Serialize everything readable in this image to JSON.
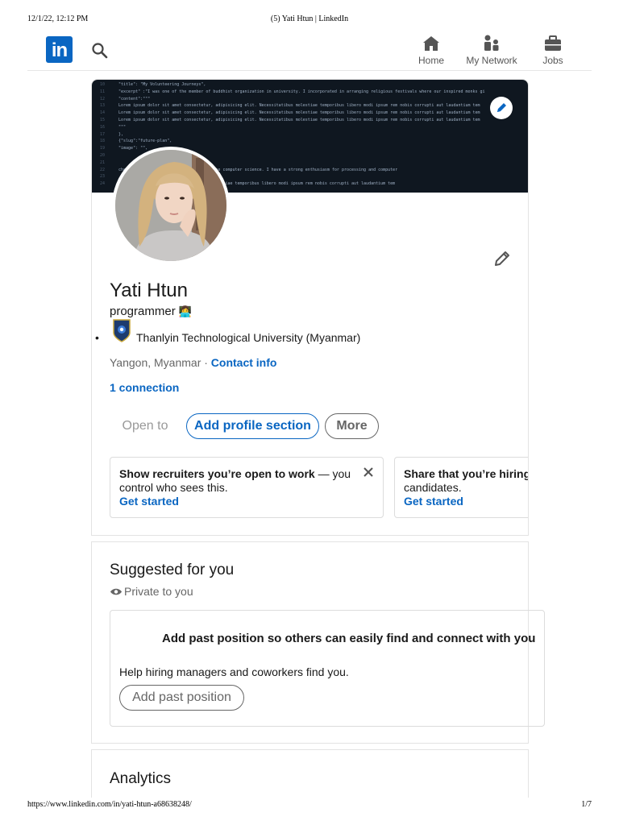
{
  "print": {
    "date": "12/1/22, 12:12 PM",
    "title": "(5) Yati Htun | LinkedIn",
    "url": "https://www.linkedin.com/in/yati-htun-a68638248/",
    "page": "1/7"
  },
  "nav": {
    "logo_text": "in",
    "items": [
      {
        "label": "Home",
        "icon": "home-icon"
      },
      {
        "label": "My Network",
        "icon": "network-icon"
      },
      {
        "label": "Jobs",
        "icon": "briefcase-icon"
      }
    ]
  },
  "banner": {
    "code_lines": [
      {
        "n": "10",
        "text": "    \"title\": \"My Volunteering Journeys\","
      },
      {
        "n": "11",
        "text": "    \"excerpt\" :\"I was one of the member of buddhist organization in university. I incorporated in arranging religious festivals where our inspired monks gi"
      },
      {
        "n": "12",
        "text": "    \"content\":\"\"\""
      },
      {
        "n": "13",
        "text": "      Lorem ipsum dolor sit amet consectetur, adipisicing elit. Necessitatibus molestiae temporibus libero modi ipsum rem nobis corrupti aut laudantium tem"
      },
      {
        "n": "14",
        "text": "      Lorem ipsum dolor sit amet consectetur, adipisicing elit. Necessitatibus molestiae temporibus libero modi ipsum rem nobis corrupti aut laudantium tem"
      },
      {
        "n": "15",
        "text": "      Lorem ipsum dolor sit amet consectetur, adipisicing elit. Necessitatibus molestiae temporibus libero modi ipsum rem nobis corrupti aut laudantium tem"
      },
      {
        "n": "16",
        "text": "    \"\"\""
      },
      {
        "n": "17",
        "text": "  },"
      },
      {
        "n": "18",
        "text": "  {\"slug\":\"future-plan\","
      },
      {
        "n": "19",
        "text": "    \"image\": \"\","
      },
      {
        "n": "20",
        "text": ""
      },
      {
        "n": "21",
        "text": ""
      },
      {
        "n": "22",
        "text": "                            challenging to myself , I became to choose computer science. I have a strong enthusiasm for processing and computer"
      },
      {
        "n": "23",
        "text": ""
      },
      {
        "n": "24",
        "text": "                            tur, adipisicing elit. Necessitatibus molestiae temporibus libero modi ipsum rem nobis corrupti aut laudantium tem"
      }
    ]
  },
  "profile": {
    "name": "Yati Htun",
    "headline": "programmer",
    "headline_emoji": "👩‍💻",
    "school": "Thanlyin Technological University (Myanmar)",
    "location": "Yangon, Myanmar · ",
    "contact_info": "Contact info",
    "connections": "1 connection",
    "buttons": {
      "open_to": "Open to",
      "add_section": "Add profile section",
      "more": "More"
    }
  },
  "promos": [
    {
      "bold": "Show recruiters you’re open to work",
      "rest": " — you control who sees this.",
      "link": "Get started"
    },
    {
      "bold": "Share that you’re hiring",
      "rest": " and attract qualified candidates.",
      "link": "Get started"
    }
  ],
  "suggested": {
    "title": "Suggested for you",
    "private": "Private to you",
    "card": {
      "heading": "Add past position so others can easily find and connect with you",
      "subtext": "Help hiring managers and coworkers find you.",
      "button": "Add past position"
    }
  },
  "analytics": {
    "title": "Analytics"
  },
  "colors": {
    "brand": "#0a66c2",
    "banner_bg": "#0f1720"
  }
}
